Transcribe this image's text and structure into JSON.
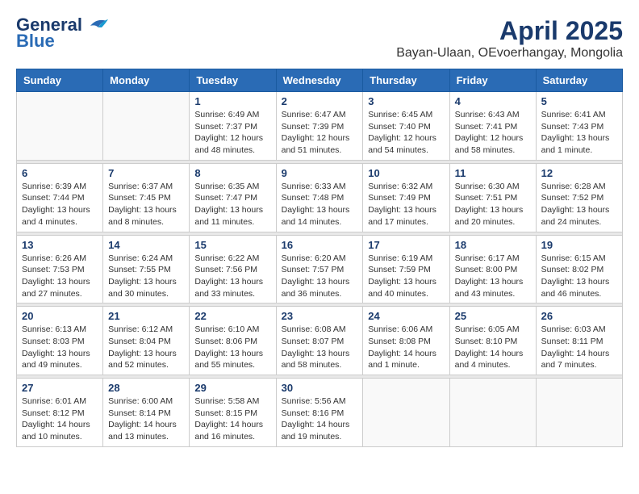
{
  "header": {
    "logo_line1": "General",
    "logo_line2": "Blue",
    "title": "April 2025",
    "subtitle": "Bayan-Ulaan, OEvoerhangay, Mongolia"
  },
  "weekdays": [
    "Sunday",
    "Monday",
    "Tuesday",
    "Wednesday",
    "Thursday",
    "Friday",
    "Saturday"
  ],
  "weeks": [
    [
      {
        "day": "",
        "info": ""
      },
      {
        "day": "",
        "info": ""
      },
      {
        "day": "1",
        "info": "Sunrise: 6:49 AM\nSunset: 7:37 PM\nDaylight: 12 hours\nand 48 minutes."
      },
      {
        "day": "2",
        "info": "Sunrise: 6:47 AM\nSunset: 7:39 PM\nDaylight: 12 hours\nand 51 minutes."
      },
      {
        "day": "3",
        "info": "Sunrise: 6:45 AM\nSunset: 7:40 PM\nDaylight: 12 hours\nand 54 minutes."
      },
      {
        "day": "4",
        "info": "Sunrise: 6:43 AM\nSunset: 7:41 PM\nDaylight: 12 hours\nand 58 minutes."
      },
      {
        "day": "5",
        "info": "Sunrise: 6:41 AM\nSunset: 7:43 PM\nDaylight: 13 hours\nand 1 minute."
      }
    ],
    [
      {
        "day": "6",
        "info": "Sunrise: 6:39 AM\nSunset: 7:44 PM\nDaylight: 13 hours\nand 4 minutes."
      },
      {
        "day": "7",
        "info": "Sunrise: 6:37 AM\nSunset: 7:45 PM\nDaylight: 13 hours\nand 8 minutes."
      },
      {
        "day": "8",
        "info": "Sunrise: 6:35 AM\nSunset: 7:47 PM\nDaylight: 13 hours\nand 11 minutes."
      },
      {
        "day": "9",
        "info": "Sunrise: 6:33 AM\nSunset: 7:48 PM\nDaylight: 13 hours\nand 14 minutes."
      },
      {
        "day": "10",
        "info": "Sunrise: 6:32 AM\nSunset: 7:49 PM\nDaylight: 13 hours\nand 17 minutes."
      },
      {
        "day": "11",
        "info": "Sunrise: 6:30 AM\nSunset: 7:51 PM\nDaylight: 13 hours\nand 20 minutes."
      },
      {
        "day": "12",
        "info": "Sunrise: 6:28 AM\nSunset: 7:52 PM\nDaylight: 13 hours\nand 24 minutes."
      }
    ],
    [
      {
        "day": "13",
        "info": "Sunrise: 6:26 AM\nSunset: 7:53 PM\nDaylight: 13 hours\nand 27 minutes."
      },
      {
        "day": "14",
        "info": "Sunrise: 6:24 AM\nSunset: 7:55 PM\nDaylight: 13 hours\nand 30 minutes."
      },
      {
        "day": "15",
        "info": "Sunrise: 6:22 AM\nSunset: 7:56 PM\nDaylight: 13 hours\nand 33 minutes."
      },
      {
        "day": "16",
        "info": "Sunrise: 6:20 AM\nSunset: 7:57 PM\nDaylight: 13 hours\nand 36 minutes."
      },
      {
        "day": "17",
        "info": "Sunrise: 6:19 AM\nSunset: 7:59 PM\nDaylight: 13 hours\nand 40 minutes."
      },
      {
        "day": "18",
        "info": "Sunrise: 6:17 AM\nSunset: 8:00 PM\nDaylight: 13 hours\nand 43 minutes."
      },
      {
        "day": "19",
        "info": "Sunrise: 6:15 AM\nSunset: 8:02 PM\nDaylight: 13 hours\nand 46 minutes."
      }
    ],
    [
      {
        "day": "20",
        "info": "Sunrise: 6:13 AM\nSunset: 8:03 PM\nDaylight: 13 hours\nand 49 minutes."
      },
      {
        "day": "21",
        "info": "Sunrise: 6:12 AM\nSunset: 8:04 PM\nDaylight: 13 hours\nand 52 minutes."
      },
      {
        "day": "22",
        "info": "Sunrise: 6:10 AM\nSunset: 8:06 PM\nDaylight: 13 hours\nand 55 minutes."
      },
      {
        "day": "23",
        "info": "Sunrise: 6:08 AM\nSunset: 8:07 PM\nDaylight: 13 hours\nand 58 minutes."
      },
      {
        "day": "24",
        "info": "Sunrise: 6:06 AM\nSunset: 8:08 PM\nDaylight: 14 hours\nand 1 minute."
      },
      {
        "day": "25",
        "info": "Sunrise: 6:05 AM\nSunset: 8:10 PM\nDaylight: 14 hours\nand 4 minutes."
      },
      {
        "day": "26",
        "info": "Sunrise: 6:03 AM\nSunset: 8:11 PM\nDaylight: 14 hours\nand 7 minutes."
      }
    ],
    [
      {
        "day": "27",
        "info": "Sunrise: 6:01 AM\nSunset: 8:12 PM\nDaylight: 14 hours\nand 10 minutes."
      },
      {
        "day": "28",
        "info": "Sunrise: 6:00 AM\nSunset: 8:14 PM\nDaylight: 14 hours\nand 13 minutes."
      },
      {
        "day": "29",
        "info": "Sunrise: 5:58 AM\nSunset: 8:15 PM\nDaylight: 14 hours\nand 16 minutes."
      },
      {
        "day": "30",
        "info": "Sunrise: 5:56 AM\nSunset: 8:16 PM\nDaylight: 14 hours\nand 19 minutes."
      },
      {
        "day": "",
        "info": ""
      },
      {
        "day": "",
        "info": ""
      },
      {
        "day": "",
        "info": ""
      }
    ]
  ]
}
